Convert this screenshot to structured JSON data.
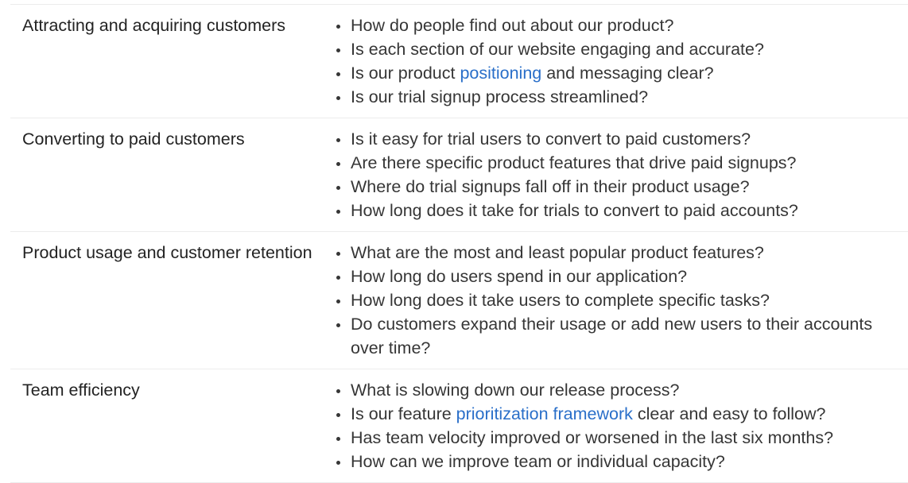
{
  "colors": {
    "text_category": "#232323",
    "text_question": "#363636",
    "link": "#2a6fc9",
    "divider": "#ececec"
  },
  "rows": [
    {
      "category": "Attracting and acquiring customers",
      "questions": [
        {
          "before": "How do people find out about our product?",
          "link": "",
          "after": ""
        },
        {
          "before": "Is each section of our website engaging and accurate?",
          "link": "",
          "after": ""
        },
        {
          "before": "Is our product ",
          "link": "positioning",
          "after": " and messaging clear?"
        },
        {
          "before": "Is our trial signup process streamlined?",
          "link": "",
          "after": ""
        }
      ]
    },
    {
      "category": "Converting to paid customers",
      "questions": [
        {
          "before": "Is it easy for trial users to convert to paid customers?",
          "link": "",
          "after": ""
        },
        {
          "before": "Are there specific product features that drive paid signups?",
          "link": "",
          "after": ""
        },
        {
          "before": "Where do trial signups fall off in their product usage?",
          "link": "",
          "after": ""
        },
        {
          "before": "How long does it take for trials to convert to paid accounts?",
          "link": "",
          "after": ""
        }
      ]
    },
    {
      "category": "Product usage and customer retention",
      "questions": [
        {
          "before": "What are the most and least popular product features?",
          "link": "",
          "after": ""
        },
        {
          "before": "How long do users spend in our application?",
          "link": "",
          "after": ""
        },
        {
          "before": "How long does it take users to complete specific tasks?",
          "link": "",
          "after": ""
        },
        {
          "before": "Do customers expand their usage or add new users to their accounts over time?",
          "link": "",
          "after": ""
        }
      ]
    },
    {
      "category": "Team efficiency",
      "questions": [
        {
          "before": "What is slowing down our release process?",
          "link": "",
          "after": ""
        },
        {
          "before": "Is our feature ",
          "link": "prioritization framework",
          "after": " clear and easy to follow?"
        },
        {
          "before": "Has team velocity improved or worsened in the last six months?",
          "link": "",
          "after": ""
        },
        {
          "before": "How can we improve team or individual capacity?",
          "link": "",
          "after": ""
        }
      ]
    }
  ]
}
